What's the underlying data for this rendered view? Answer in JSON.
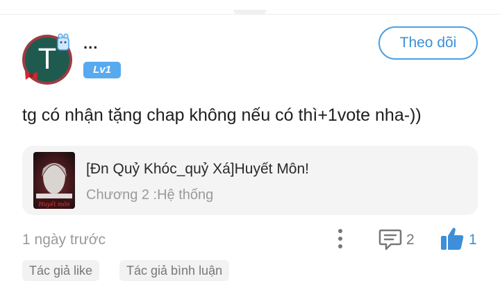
{
  "comment": {
    "user": {
      "name": "...",
      "avatar_letter": "T",
      "level": "Lv1"
    },
    "follow_label": "Theo dõi",
    "text": "tg có nhận tặng chap không nếu có thì+1vote nha-))",
    "story": {
      "title": "[Đn Quỷ Khóc_quỷ Xá]Huyết Môn!",
      "chapter": "Chương 2 :Hệ thống",
      "cover_text": "Huyết môn"
    },
    "time": "1 ngày trước",
    "reply_count": "2",
    "like_count": "1",
    "tags": [
      "Tác giả like",
      "Tác giả bình luận"
    ]
  },
  "colors": {
    "accent": "#3c8fd8",
    "level_badge": "#58aaf0",
    "avatar_ring": "#9a3d43",
    "avatar_fill": "#1f5a4f",
    "card_bg": "#f4f4f4"
  },
  "icons": [
    "more-vertical-icon",
    "comment-icon",
    "thumbs-up-icon"
  ]
}
